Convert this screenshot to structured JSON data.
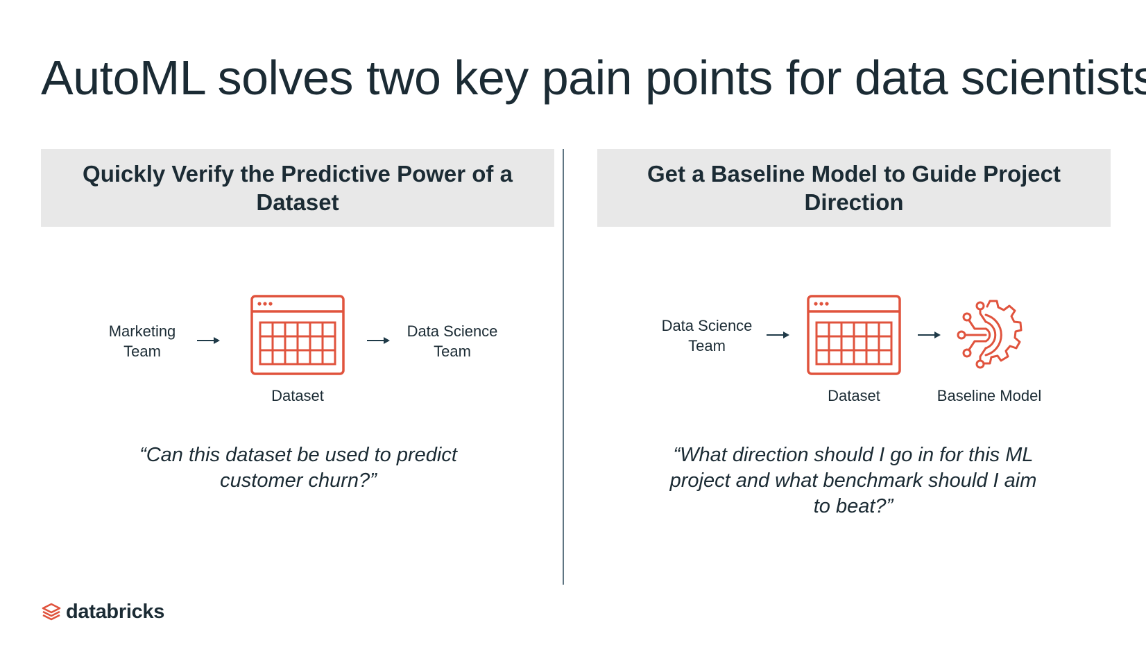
{
  "title": "AutoML solves two key pain points for data scientists",
  "left": {
    "header": "Quickly Verify the Predictive Power of a Dataset",
    "source_label": "Marketing\nTeam",
    "dataset_label": "Dataset",
    "target_label": "Data Science\nTeam",
    "quote": "“Can this dataset be used to predict customer churn?”"
  },
  "right": {
    "header": "Get a Baseline Model to Guide Project Direction",
    "source_label": "Data Science\nTeam",
    "dataset_label": "Dataset",
    "model_label": "Baseline Model",
    "quote": "“What direction should I go in for this ML project and what benchmark should I aim to beat?”"
  },
  "logo": {
    "text": "databricks"
  },
  "colors": {
    "accent": "#e0533d",
    "arrow": "#1f3a48",
    "divider": "#5f7582",
    "header_bg": "#e8e8e8"
  },
  "icons": [
    "dataset-table-icon",
    "baseline-model-gear-icon",
    "arrow-right-icon",
    "databricks-logo-icon"
  ]
}
